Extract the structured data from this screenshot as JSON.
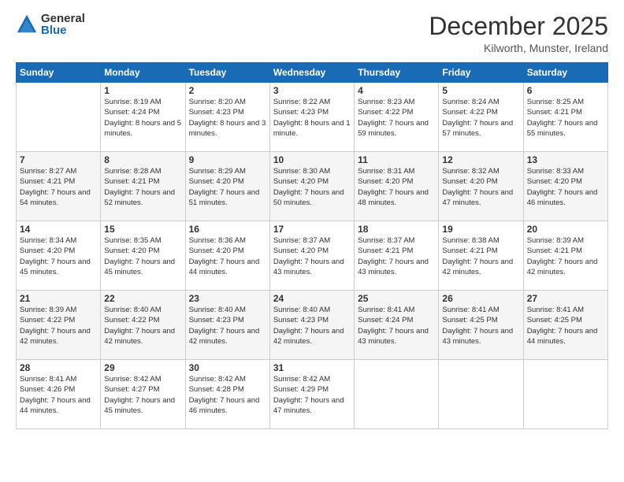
{
  "logo": {
    "general": "General",
    "blue": "Blue"
  },
  "title": "December 2025",
  "subtitle": "Kilworth, Munster, Ireland",
  "days_of_week": [
    "Sunday",
    "Monday",
    "Tuesday",
    "Wednesday",
    "Thursday",
    "Friday",
    "Saturday"
  ],
  "weeks": [
    [
      {
        "day": "",
        "sunrise": "",
        "sunset": "",
        "daylight": ""
      },
      {
        "day": "1",
        "sunrise": "Sunrise: 8:19 AM",
        "sunset": "Sunset: 4:24 PM",
        "daylight": "Daylight: 8 hours and 5 minutes."
      },
      {
        "day": "2",
        "sunrise": "Sunrise: 8:20 AM",
        "sunset": "Sunset: 4:23 PM",
        "daylight": "Daylight: 8 hours and 3 minutes."
      },
      {
        "day": "3",
        "sunrise": "Sunrise: 8:22 AM",
        "sunset": "Sunset: 4:23 PM",
        "daylight": "Daylight: 8 hours and 1 minute."
      },
      {
        "day": "4",
        "sunrise": "Sunrise: 8:23 AM",
        "sunset": "Sunset: 4:22 PM",
        "daylight": "Daylight: 7 hours and 59 minutes."
      },
      {
        "day": "5",
        "sunrise": "Sunrise: 8:24 AM",
        "sunset": "Sunset: 4:22 PM",
        "daylight": "Daylight: 7 hours and 57 minutes."
      },
      {
        "day": "6",
        "sunrise": "Sunrise: 8:25 AM",
        "sunset": "Sunset: 4:21 PM",
        "daylight": "Daylight: 7 hours and 55 minutes."
      }
    ],
    [
      {
        "day": "7",
        "sunrise": "Sunrise: 8:27 AM",
        "sunset": "Sunset: 4:21 PM",
        "daylight": "Daylight: 7 hours and 54 minutes."
      },
      {
        "day": "8",
        "sunrise": "Sunrise: 8:28 AM",
        "sunset": "Sunset: 4:21 PM",
        "daylight": "Daylight: 7 hours and 52 minutes."
      },
      {
        "day": "9",
        "sunrise": "Sunrise: 8:29 AM",
        "sunset": "Sunset: 4:20 PM",
        "daylight": "Daylight: 7 hours and 51 minutes."
      },
      {
        "day": "10",
        "sunrise": "Sunrise: 8:30 AM",
        "sunset": "Sunset: 4:20 PM",
        "daylight": "Daylight: 7 hours and 50 minutes."
      },
      {
        "day": "11",
        "sunrise": "Sunrise: 8:31 AM",
        "sunset": "Sunset: 4:20 PM",
        "daylight": "Daylight: 7 hours and 48 minutes."
      },
      {
        "day": "12",
        "sunrise": "Sunrise: 8:32 AM",
        "sunset": "Sunset: 4:20 PM",
        "daylight": "Daylight: 7 hours and 47 minutes."
      },
      {
        "day": "13",
        "sunrise": "Sunrise: 8:33 AM",
        "sunset": "Sunset: 4:20 PM",
        "daylight": "Daylight: 7 hours and 46 minutes."
      }
    ],
    [
      {
        "day": "14",
        "sunrise": "Sunrise: 8:34 AM",
        "sunset": "Sunset: 4:20 PM",
        "daylight": "Daylight: 7 hours and 45 minutes."
      },
      {
        "day": "15",
        "sunrise": "Sunrise: 8:35 AM",
        "sunset": "Sunset: 4:20 PM",
        "daylight": "Daylight: 7 hours and 45 minutes."
      },
      {
        "day": "16",
        "sunrise": "Sunrise: 8:36 AM",
        "sunset": "Sunset: 4:20 PM",
        "daylight": "Daylight: 7 hours and 44 minutes."
      },
      {
        "day": "17",
        "sunrise": "Sunrise: 8:37 AM",
        "sunset": "Sunset: 4:20 PM",
        "daylight": "Daylight: 7 hours and 43 minutes."
      },
      {
        "day": "18",
        "sunrise": "Sunrise: 8:37 AM",
        "sunset": "Sunset: 4:21 PM",
        "daylight": "Daylight: 7 hours and 43 minutes."
      },
      {
        "day": "19",
        "sunrise": "Sunrise: 8:38 AM",
        "sunset": "Sunset: 4:21 PM",
        "daylight": "Daylight: 7 hours and 42 minutes."
      },
      {
        "day": "20",
        "sunrise": "Sunrise: 8:39 AM",
        "sunset": "Sunset: 4:21 PM",
        "daylight": "Daylight: 7 hours and 42 minutes."
      }
    ],
    [
      {
        "day": "21",
        "sunrise": "Sunrise: 8:39 AM",
        "sunset": "Sunset: 4:22 PM",
        "daylight": "Daylight: 7 hours and 42 minutes."
      },
      {
        "day": "22",
        "sunrise": "Sunrise: 8:40 AM",
        "sunset": "Sunset: 4:22 PM",
        "daylight": "Daylight: 7 hours and 42 minutes."
      },
      {
        "day": "23",
        "sunrise": "Sunrise: 8:40 AM",
        "sunset": "Sunset: 4:23 PM",
        "daylight": "Daylight: 7 hours and 42 minutes."
      },
      {
        "day": "24",
        "sunrise": "Sunrise: 8:40 AM",
        "sunset": "Sunset: 4:23 PM",
        "daylight": "Daylight: 7 hours and 42 minutes."
      },
      {
        "day": "25",
        "sunrise": "Sunrise: 8:41 AM",
        "sunset": "Sunset: 4:24 PM",
        "daylight": "Daylight: 7 hours and 43 minutes."
      },
      {
        "day": "26",
        "sunrise": "Sunrise: 8:41 AM",
        "sunset": "Sunset: 4:25 PM",
        "daylight": "Daylight: 7 hours and 43 minutes."
      },
      {
        "day": "27",
        "sunrise": "Sunrise: 8:41 AM",
        "sunset": "Sunset: 4:25 PM",
        "daylight": "Daylight: 7 hours and 44 minutes."
      }
    ],
    [
      {
        "day": "28",
        "sunrise": "Sunrise: 8:41 AM",
        "sunset": "Sunset: 4:26 PM",
        "daylight": "Daylight: 7 hours and 44 minutes."
      },
      {
        "day": "29",
        "sunrise": "Sunrise: 8:42 AM",
        "sunset": "Sunset: 4:27 PM",
        "daylight": "Daylight: 7 hours and 45 minutes."
      },
      {
        "day": "30",
        "sunrise": "Sunrise: 8:42 AM",
        "sunset": "Sunset: 4:28 PM",
        "daylight": "Daylight: 7 hours and 46 minutes."
      },
      {
        "day": "31",
        "sunrise": "Sunrise: 8:42 AM",
        "sunset": "Sunset: 4:29 PM",
        "daylight": "Daylight: 7 hours and 47 minutes."
      },
      {
        "day": "",
        "sunrise": "",
        "sunset": "",
        "daylight": ""
      },
      {
        "day": "",
        "sunrise": "",
        "sunset": "",
        "daylight": ""
      },
      {
        "day": "",
        "sunrise": "",
        "sunset": "",
        "daylight": ""
      }
    ]
  ]
}
